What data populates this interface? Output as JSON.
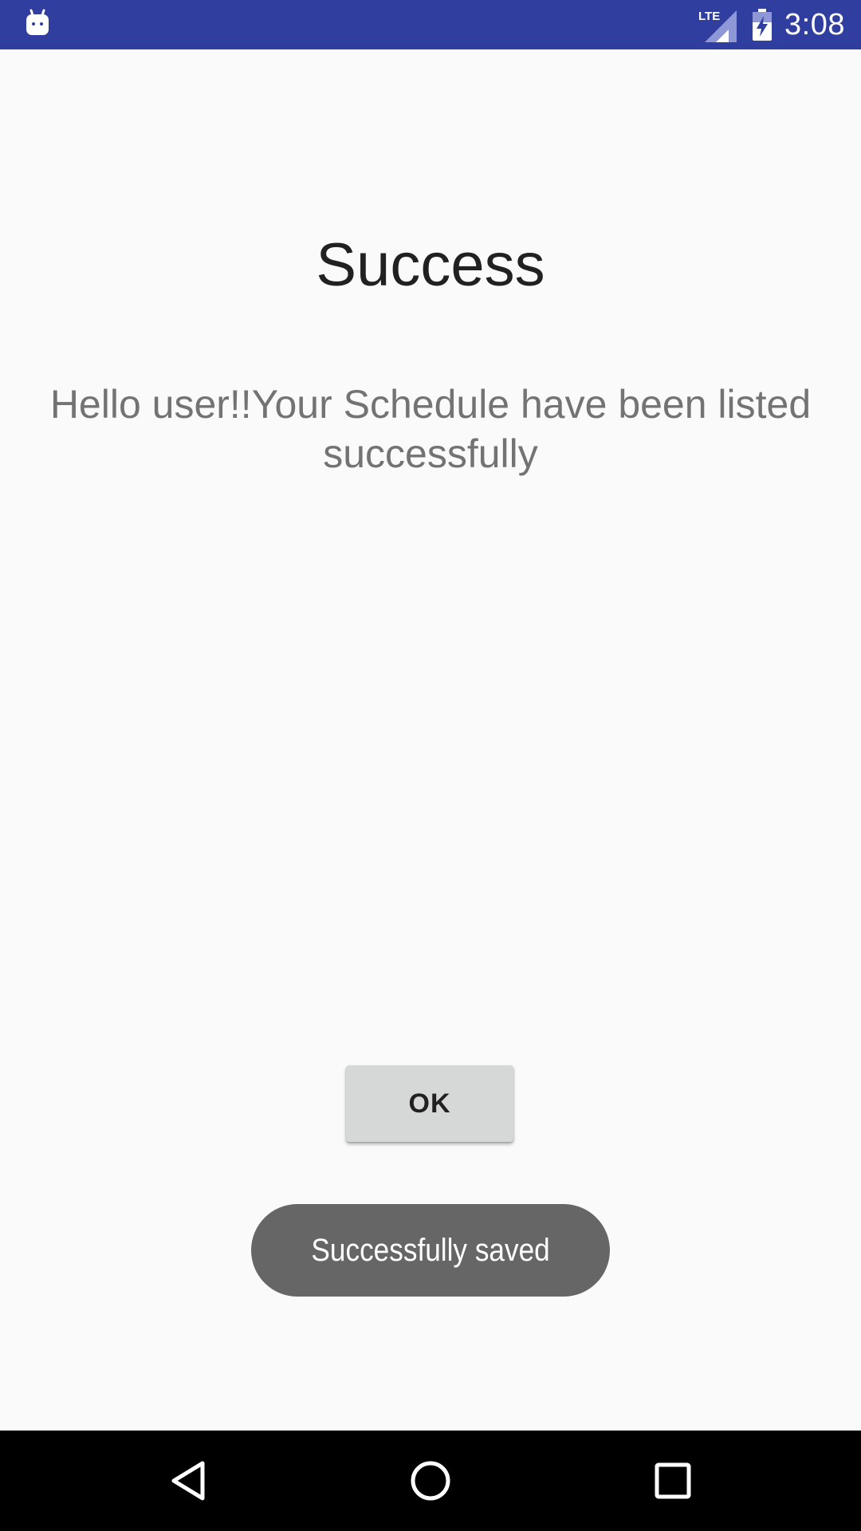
{
  "status_bar": {
    "network_label": "LTE",
    "time": "3:08",
    "icons": [
      "android-notification-icon",
      "lte-signal-icon",
      "battery-charging-icon"
    ]
  },
  "main": {
    "title": "Success",
    "message": "Hello user!!Your Schedule have been listed successfully",
    "ok_label": "OK"
  },
  "toast": {
    "text": "Successfully saved"
  },
  "nav_bar": {
    "icons": [
      "back-icon",
      "home-icon",
      "recents-icon"
    ]
  },
  "colors": {
    "status_bar": "#303f9f",
    "background": "#fafafa",
    "button": "#d6d7d7",
    "toast": "#666666",
    "nav_bar": "#000000"
  }
}
